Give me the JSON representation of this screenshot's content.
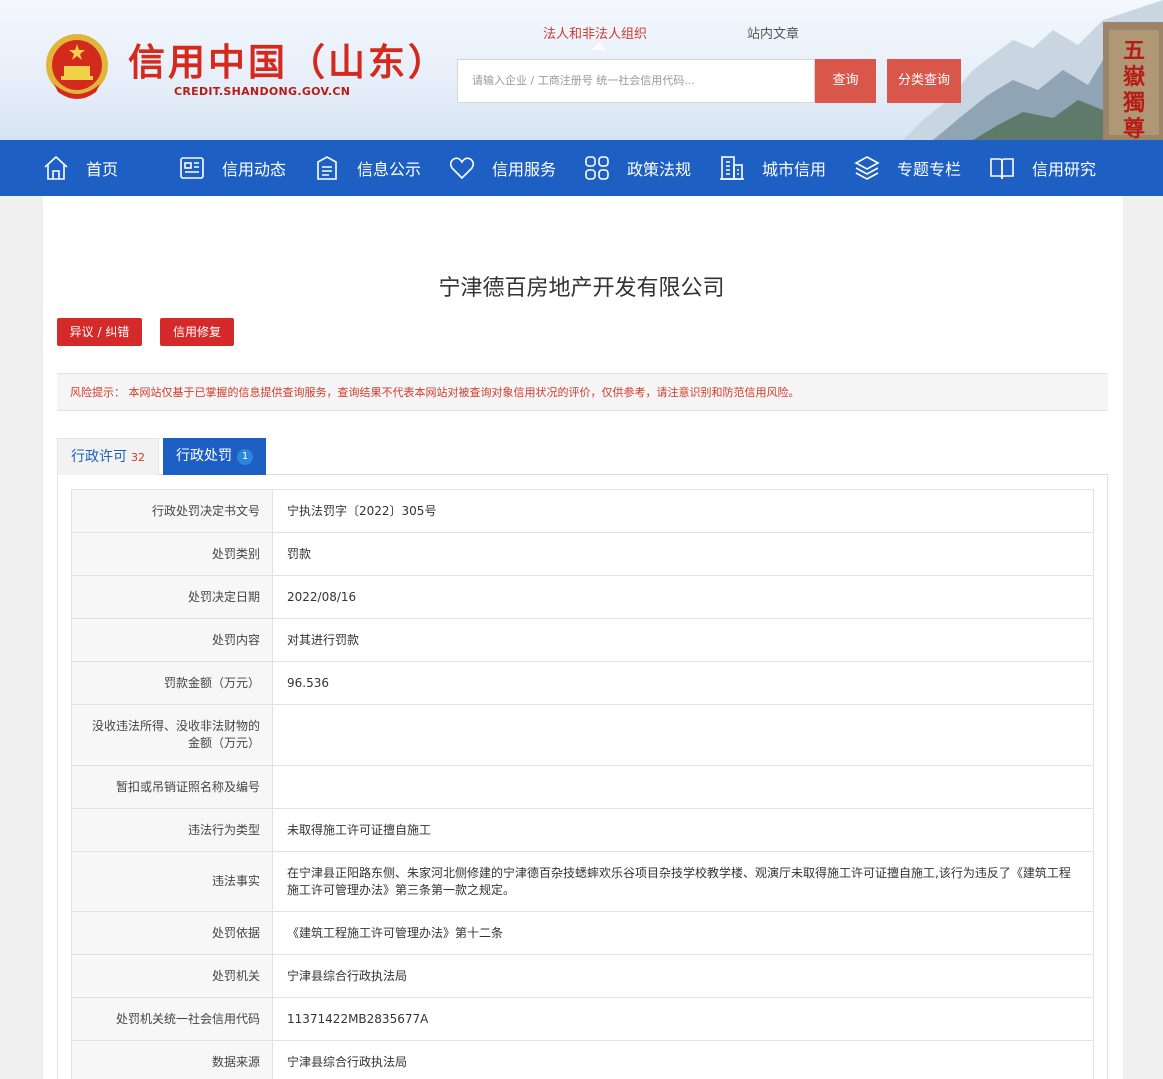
{
  "header": {
    "logo_title": "信用中国（山东）",
    "logo_subtitle": "CREDIT.SHANDONG.GOV.CN",
    "search_tabs": [
      "法人和非法人组织",
      "站内文章"
    ],
    "search_placeholder": "请输入企业 / 工商注册号 统一社会信用代码...",
    "query_button": "查询",
    "category_button": "分类查询"
  },
  "nav": {
    "items": [
      {
        "label": "首页",
        "icon": "home-icon"
      },
      {
        "label": "信用动态",
        "icon": "news-icon"
      },
      {
        "label": "信息公示",
        "icon": "document-icon"
      },
      {
        "label": "信用服务",
        "icon": "heart-icon"
      },
      {
        "label": "政策法规",
        "icon": "grid-icon"
      },
      {
        "label": "城市信用",
        "icon": "building-icon"
      },
      {
        "label": "专题专栏",
        "icon": "layers-icon"
      },
      {
        "label": "信用研究",
        "icon": "book-icon"
      }
    ]
  },
  "main": {
    "company_name": "宁津德百房地产开发有限公司",
    "objection_button": "异议 / 纠错",
    "repair_button": "信用修复",
    "risk_notice": "风险提示： 本网站仅基于已掌握的信息提供查询服务，查询结果不代表本网站对被查询对象信用状况的评价，仅供参考，请注意识别和防范信用风险。",
    "tabs": [
      {
        "label": "行政许可",
        "count": "32"
      },
      {
        "label": "行政处罚",
        "count": "1"
      }
    ],
    "rows": [
      {
        "key": "行政处罚决定书文号",
        "value": "宁执法罚字〔2022〕305号"
      },
      {
        "key": "处罚类别",
        "value": "罚款"
      },
      {
        "key": "处罚决定日期",
        "value": "2022/08/16"
      },
      {
        "key": "处罚内容",
        "value": "对其进行罚款"
      },
      {
        "key": "罚款金额（万元）",
        "value": "96.536"
      },
      {
        "key": "没收违法所得、没收非法财物的金额（万元）",
        "value": ""
      },
      {
        "key": "暂扣或吊销证照名称及编号",
        "value": ""
      },
      {
        "key": "违法行为类型",
        "value": "未取得施工许可证擅自施工"
      },
      {
        "key": "违法事实",
        "value": "在宁津县正阳路东侧、朱家河北侧修建的宁津德百杂技蟋蟀欢乐谷项目杂技学校教学楼、观演厅未取得施工许可证擅自施工,该行为违反了《建筑工程施工许可管理办法》第三条第一款之规定。"
      },
      {
        "key": "处罚依据",
        "value": "《建筑工程施工许可管理办法》第十二条"
      },
      {
        "key": "处罚机关",
        "value": "宁津县综合行政执法局"
      },
      {
        "key": "处罚机关统一社会信用代码",
        "value": "11371422MB2835677A"
      },
      {
        "key": "数据来源",
        "value": "宁津县综合行政执法局"
      }
    ]
  },
  "colors": {
    "brand_red": "#d42a1e",
    "nav_blue": "#1d5fc3",
    "button_red": "#d42a2a"
  }
}
